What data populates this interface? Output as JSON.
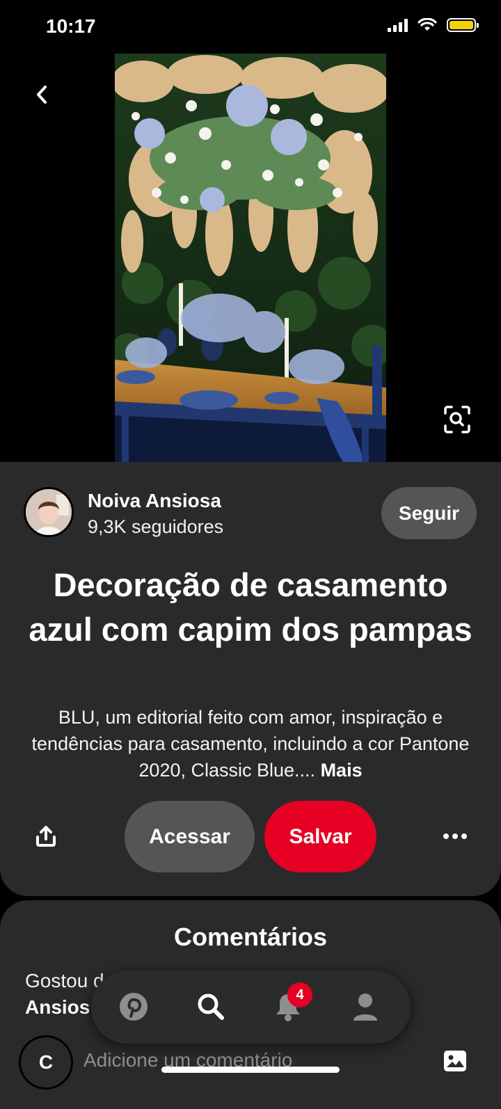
{
  "status_bar": {
    "time": "10:17",
    "battery_color": "#f5d10a"
  },
  "pin": {
    "image_alt": "Decoração de casamento azul com capim dos pampas",
    "creator": {
      "name": "Noiva Ansiosa",
      "followers": "9,3K seguidores"
    },
    "follow_label": "Seguir",
    "title": "Decoração de casamento azul com capim dos pampas",
    "description": "BLU, um editorial feito com amor, inspiração e tendências para casamento, incluindo a cor Pantone 2020, Classic Blue....",
    "more_label": "Mais",
    "visit_label": "Acessar",
    "save_label": "Salvar",
    "save_color": "#e60023"
  },
  "comments": {
    "title": "Comentários",
    "prompt_line1": "Gostou d",
    "prompt_line2": "Ansios",
    "avatar_initial": "C",
    "input_placeholder": "Adicione um comentário"
  },
  "nav": {
    "items": [
      "pinterest-icon",
      "search-icon",
      "notifications-icon",
      "profile-icon"
    ],
    "notification_count": "4"
  }
}
